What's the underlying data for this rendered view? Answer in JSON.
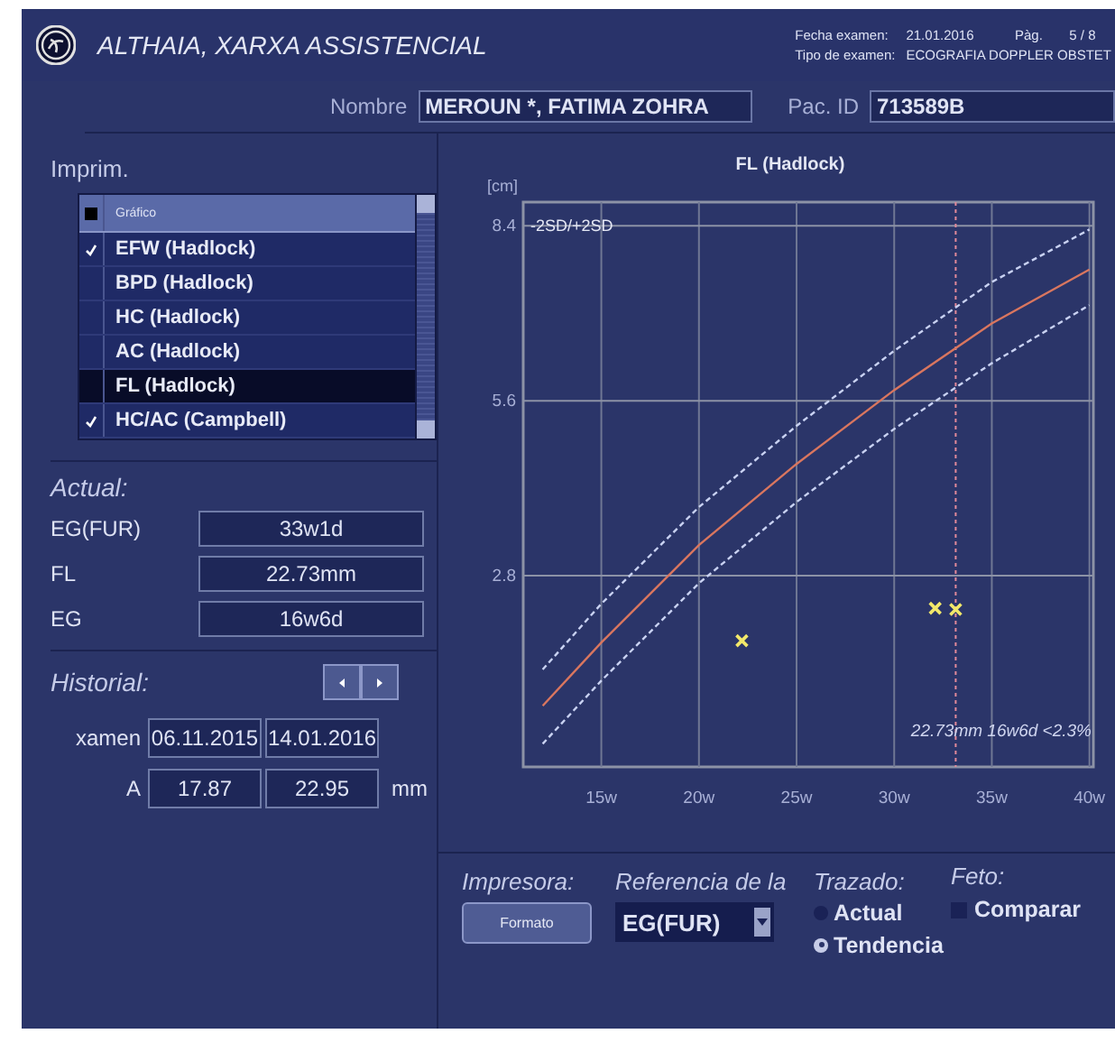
{
  "header": {
    "title": "ALTHAIA, XARXA ASSISTENCIAL",
    "exam_date_label": "Fecha examen:",
    "exam_date": "21.01.2016",
    "page_label": "Pàg.",
    "page": "5 / 8",
    "exam_type_label": "Tipo de examen:",
    "exam_type": "ECOGRAFIA DOPPLER OBSTET"
  },
  "patient": {
    "name_label": "Nombre",
    "name": "MEROUN *, FATIMA ZOHRA",
    "id_label": "Pac. ID",
    "id": "713589B"
  },
  "print_list": {
    "title": "Imprim.",
    "column": "Gráfico",
    "items": [
      {
        "label": "EFW (Hadlock)",
        "checked": true,
        "selected": false
      },
      {
        "label": "BPD (Hadlock)",
        "checked": false,
        "selected": false
      },
      {
        "label": "HC (Hadlock)",
        "checked": false,
        "selected": false
      },
      {
        "label": "AC (Hadlock)",
        "checked": false,
        "selected": false
      },
      {
        "label": "FL (Hadlock)",
        "checked": false,
        "selected": true
      },
      {
        "label": "HC/AC (Campbell)",
        "checked": true,
        "selected": false
      }
    ]
  },
  "current": {
    "title": "Actual:",
    "rows": [
      {
        "label": "EG(FUR)",
        "value": "33w1d"
      },
      {
        "label": "FL",
        "value": "22.73mm"
      },
      {
        "label": "EG",
        "value": "16w6d"
      }
    ]
  },
  "history": {
    "title": "Historial:",
    "rows": [
      {
        "label": "xamen",
        "values": [
          "06.11.2015",
          "14.01.2016"
        ]
      },
      {
        "label": "A",
        "values": [
          "17.87",
          "22.95"
        ],
        "unit": "mm"
      }
    ]
  },
  "chart": {
    "chart_data": {
      "type": "line",
      "title": "FL (Hadlock)",
      "ylabel": "[cm]",
      "x": [
        12,
        15,
        20,
        25,
        30,
        35,
        40
      ],
      "xlim": [
        11,
        40.2
      ],
      "ylim": [
        -0.26,
        8.78
      ],
      "xticks": [
        {
          "value": 15,
          "label": "15w"
        },
        {
          "value": 20,
          "label": "20w"
        },
        {
          "value": 25,
          "label": "25w"
        },
        {
          "value": 30,
          "label": "30w"
        },
        {
          "value": 35,
          "label": "35w"
        },
        {
          "value": 40,
          "label": "40w"
        }
      ],
      "yticks": [
        2.8,
        5.6,
        8.4
      ],
      "grid": true,
      "series": [
        {
          "color": "#d9765f",
          "line_style": "solid",
          "values": [
            0.72,
            1.73,
            3.29,
            4.59,
            5.77,
            6.84,
            7.7
          ]
        },
        {
          "color": "#c9d2f2",
          "line_style": "dashed",
          "values": [
            1.3,
            2.35,
            3.9,
            5.2,
            6.4,
            7.5,
            8.34
          ]
        },
        {
          "color": "#c9d2f2",
          "line_style": "dashed",
          "values": [
            0.11,
            1.12,
            2.68,
            3.98,
            5.15,
            6.2,
            7.13
          ]
        },
        {
          "type": "scatter",
          "color": "#f2e86a",
          "x": [
            22.2,
            32.1,
            33.15
          ],
          "values": [
            1.76,
            2.28,
            2.26
          ]
        }
      ],
      "ref_lines": [
        {
          "axis": "x",
          "value": 33.15,
          "color": "#e28a9a"
        }
      ],
      "annotations": [
        "-2SD/+2SD",
        "22.73mm 16w6d <2.3%"
      ]
    }
  },
  "controls": {
    "printer": {
      "label": "Impresora:",
      "button": "Formato"
    },
    "reference": {
      "label": "Referencia de la",
      "value": "EG(FUR)"
    },
    "plot": {
      "label": "Trazado:",
      "options": [
        {
          "label": "Actual",
          "selected": false
        },
        {
          "label": "Tendencia",
          "selected": true
        }
      ]
    },
    "fetus": {
      "label": "Feto:",
      "compare": {
        "label": "Comparar",
        "checked": false
      }
    }
  }
}
